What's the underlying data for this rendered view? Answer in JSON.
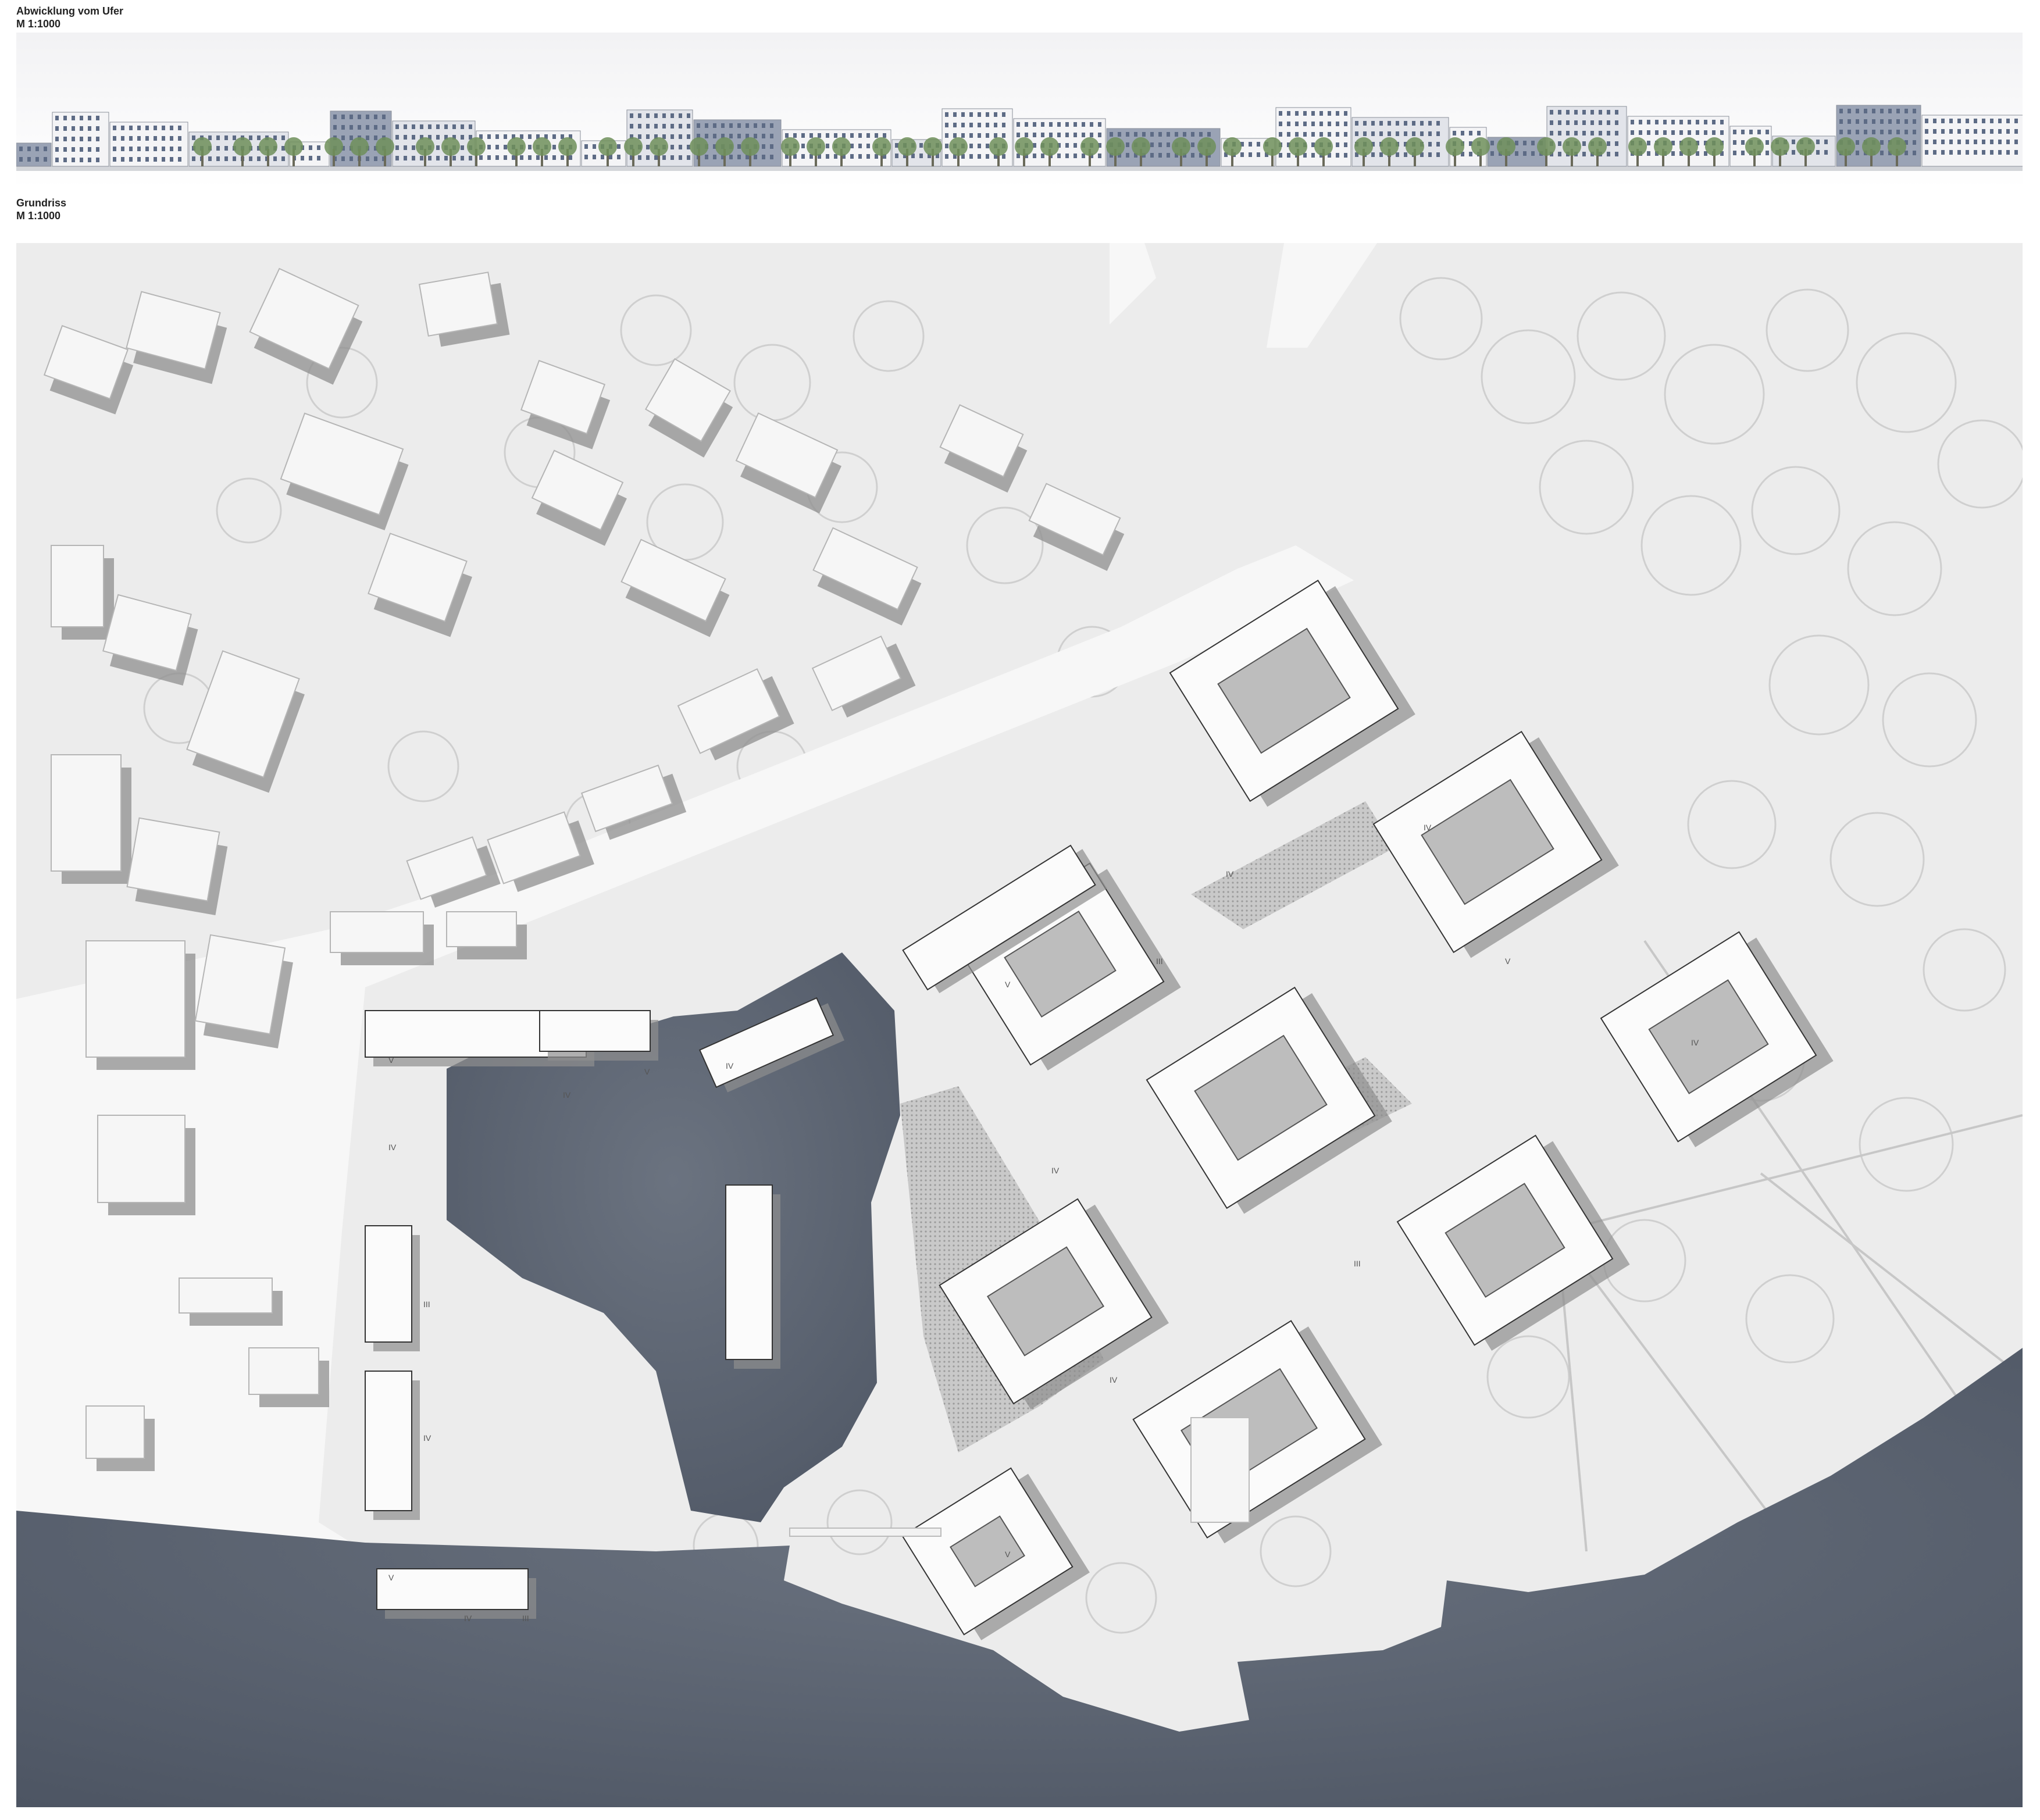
{
  "elevation": {
    "title": "Abwicklung vom Ufer",
    "scale": "M 1:1000"
  },
  "plan": {
    "title": "Grundriss",
    "scale": "M 1:1000",
    "floor_labels": [
      "V",
      "IV",
      "III",
      "IV",
      "V",
      "IV",
      "III",
      "IV",
      "V",
      "IV",
      "V",
      "IV",
      "III",
      "IV",
      "IV",
      "V",
      "IV",
      "III",
      "IV",
      "V"
    ]
  },
  "colors": {
    "water": "#5b6472",
    "ground": "#ececec",
    "building_roof": "#fafafa",
    "shadow": "#8a8a8a",
    "plaza": "#cfcfcf"
  }
}
